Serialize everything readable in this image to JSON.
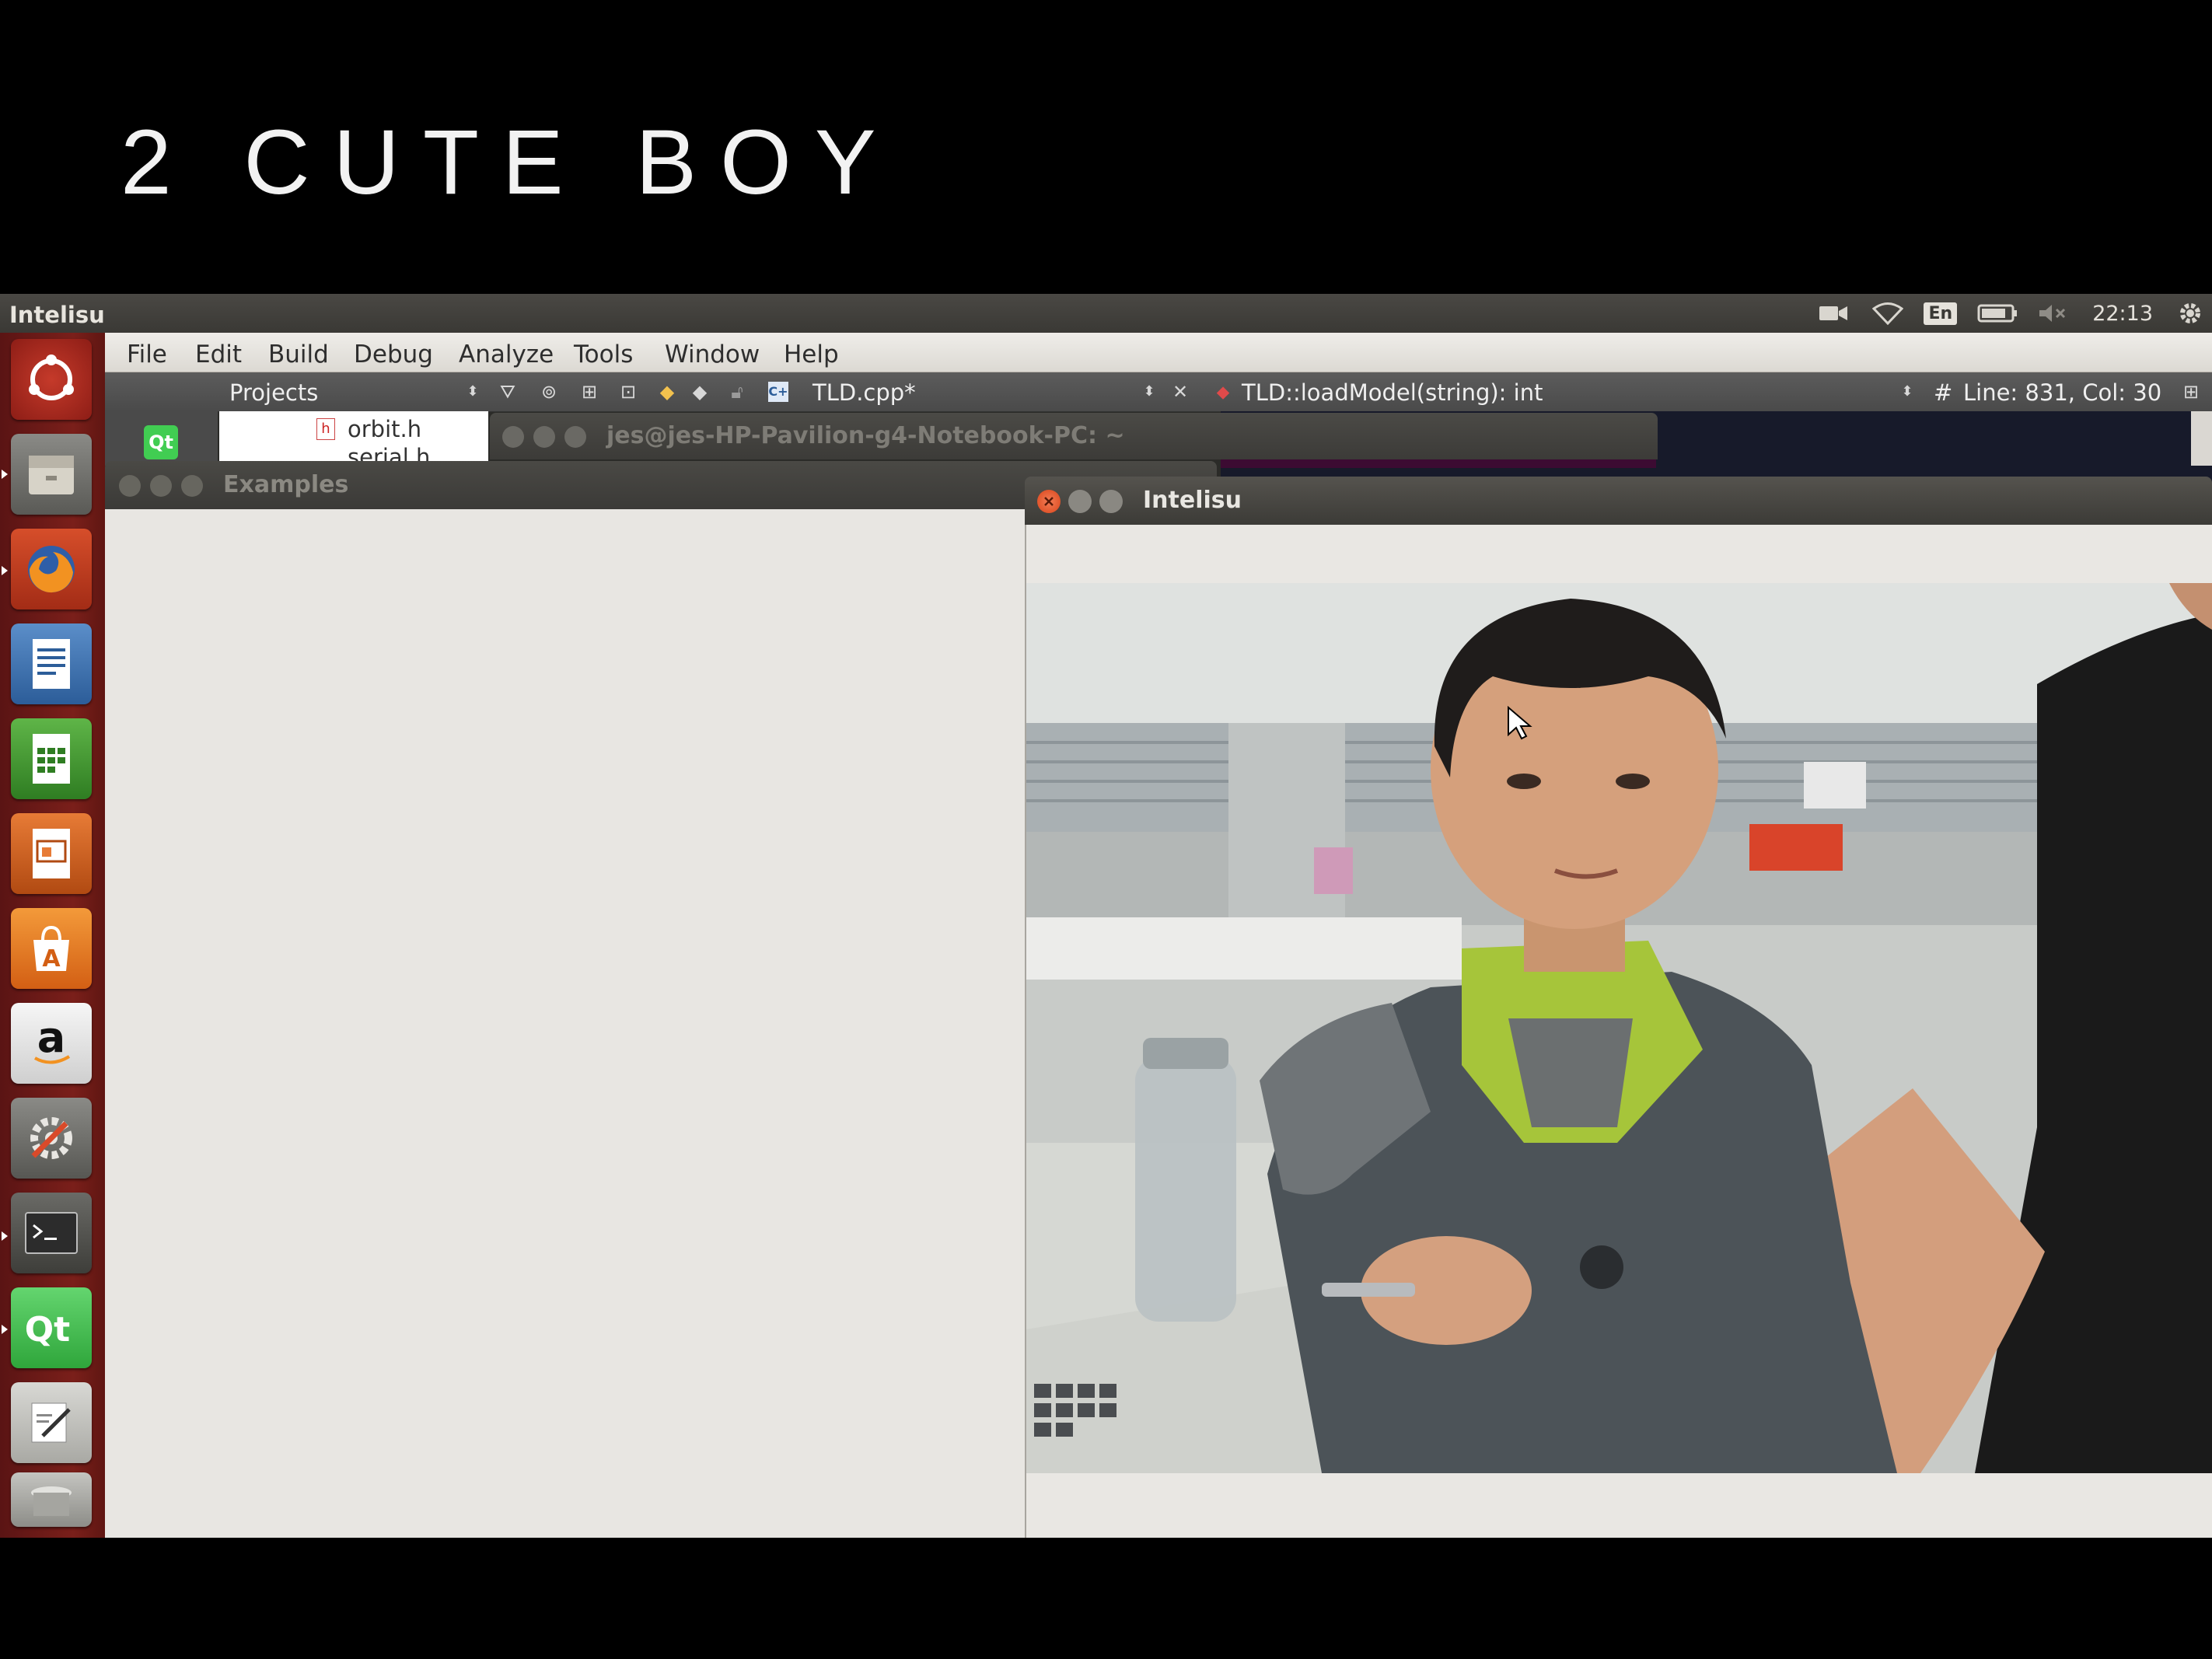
{
  "slide": {
    "title": "2 CUTE BOY"
  },
  "top_panel": {
    "app_name": "Intelisu",
    "language": "En",
    "clock": "22:13",
    "indicators": [
      "camera-icon",
      "wifi-icon",
      "language-indicator",
      "battery-icon",
      "volume-muted-icon",
      "gear-icon"
    ]
  },
  "launcher": {
    "items": [
      "dash-home",
      "files",
      "firefox",
      "libreoffice-writer",
      "libreoffice-calc",
      "libreoffice-impress",
      "ubuntu-software-center",
      "amazon",
      "system-settings",
      "terminal",
      "qt-creator",
      "text-editor",
      "trash"
    ]
  },
  "qt_creator": {
    "menu": [
      "File",
      "Edit",
      "Build",
      "Debug",
      "Analyze",
      "Tools",
      "Window",
      "Help"
    ],
    "toolbar": {
      "projects_label": "Projects",
      "current_file": "TLD.cpp*",
      "function": "TLD::loadModel(string): int",
      "hash": "#",
      "cursor_position": "Line: 831, Col: 30"
    },
    "file_list": [
      "orbit.h",
      "serial.h"
    ],
    "file_icon_letter": "h",
    "logo_text": "Qt"
  },
  "terminal_window": {
    "title": "jes@jes-HP-Pavilion-g4-Notebook-PC: ~"
  },
  "examples_window": {
    "title": "Examples"
  },
  "intelisu_window": {
    "title": "Intelisu"
  },
  "colors": {
    "launcher_bg": "#7a1f1a",
    "panel_bg": "#3c3b37",
    "window_bg": "#e8e6e2",
    "close_button": "#e95420"
  }
}
